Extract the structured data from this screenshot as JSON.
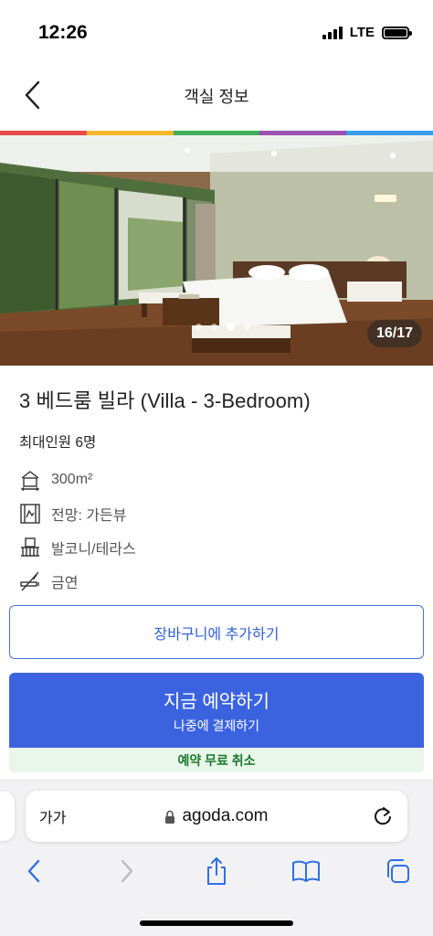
{
  "status": {
    "time": "12:26",
    "network": "LTE"
  },
  "header": {
    "title": "객실 정보",
    "back_icon": "chevron-left-icon"
  },
  "rainbow_colors": [
    "#e94b4b",
    "#f5b82e",
    "#3fae5a",
    "#9b4fb3",
    "#3a9ee8"
  ],
  "gallery": {
    "counter": "16/17",
    "dot_count": 4,
    "active_dot": 2
  },
  "room": {
    "title": "3 베드룸 빌라 (Villa - 3-Bedroom)",
    "max_guests": "최대인원 6명",
    "amenities": [
      {
        "icon": "room-size-icon",
        "label": "300m²"
      },
      {
        "icon": "view-icon",
        "label": "전망: 가든뷰"
      },
      {
        "icon": "balcony-icon",
        "label": "발코니/테라스"
      },
      {
        "icon": "no-smoking-icon",
        "label": "금연"
      }
    ]
  },
  "actions": {
    "add_to_cart": "장바구니에 추가하기",
    "book_now": "지금 예약하기",
    "pay_later": "나중에 결제하기",
    "free_cancellation": "예약 무료 취소"
  },
  "browser": {
    "text_size": "가가",
    "url": "agoda.com",
    "toolbar": [
      "back-icon",
      "forward-icon",
      "share-icon",
      "bookmarks-icon",
      "tabs-icon"
    ]
  },
  "colors": {
    "primary": "#3b63e0",
    "success": "#1a7a2c"
  }
}
